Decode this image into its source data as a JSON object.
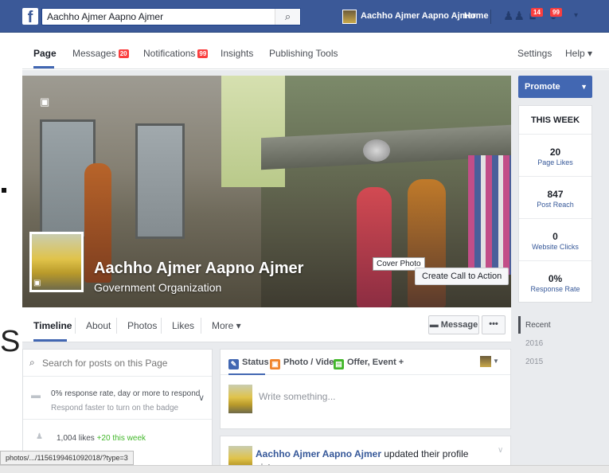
{
  "topbar": {
    "logo": "f",
    "search_value": "Aachho Ajmer Aapno Ajmer",
    "search_icon": "search-icon",
    "profile_name": "Aachho Ajmer Aapno Ajmer",
    "home": "Home",
    "friend_requests_badge": "",
    "messages_badge": "14",
    "notifications_badge": "99",
    "caret": "▾"
  },
  "pagenav": {
    "items": [
      {
        "label": "Page"
      },
      {
        "label": "Messages",
        "badge": "20"
      },
      {
        "label": "Notifications",
        "badge": "99"
      },
      {
        "label": "Insights"
      },
      {
        "label": "Publishing Tools"
      }
    ],
    "settings": "Settings",
    "help": "Help ▾"
  },
  "cover": {
    "page_name": "Aachho Ajmer Aapno Ajmer",
    "category": "Government Organization",
    "tooltip": "Cover Photo",
    "cta": "Create Call to Action"
  },
  "tabs": {
    "items": [
      {
        "label": "Timeline"
      },
      {
        "label": "About"
      },
      {
        "label": "Photos"
      },
      {
        "label": "Likes"
      },
      {
        "label": "More ▾"
      }
    ],
    "message_button": "Message",
    "more_button": "•••"
  },
  "left": {
    "search_placeholder": "Search for posts on this Page",
    "response_title": "0% response rate, day or more to respond",
    "response_sub": "Respond faster to turn on the badge",
    "likes": "1,004 likes",
    "likes_gain": "+20 this week"
  },
  "composer": {
    "tabs": [
      {
        "label": "Status",
        "color": "#4267b2"
      },
      {
        "label": "Photo / Video",
        "color": "#f0852d"
      },
      {
        "label": "Offer, Event +",
        "color": "#42b72a"
      }
    ],
    "placeholder": "Write something..."
  },
  "post": {
    "author": "Aachho Ajmer Aapno Ajmer",
    "action": "updated their profile",
    "action2": "picture."
  },
  "right": {
    "promote": "Promote",
    "week_title": "THIS WEEK",
    "stats": [
      {
        "num": "20",
        "label": "Page Likes"
      },
      {
        "num": "847",
        "label": "Post Reach"
      },
      {
        "num": "0",
        "label": "Website Clicks"
      },
      {
        "num": "0%",
        "label": "Response Rate"
      }
    ],
    "years": [
      "Recent",
      "2016",
      "2015"
    ]
  },
  "status_url": "photos/.../1156199461092018/?type=3",
  "colors": {
    "brand": "#3b5998",
    "accent": "#4267b2",
    "badge": "#fa3e3e"
  }
}
